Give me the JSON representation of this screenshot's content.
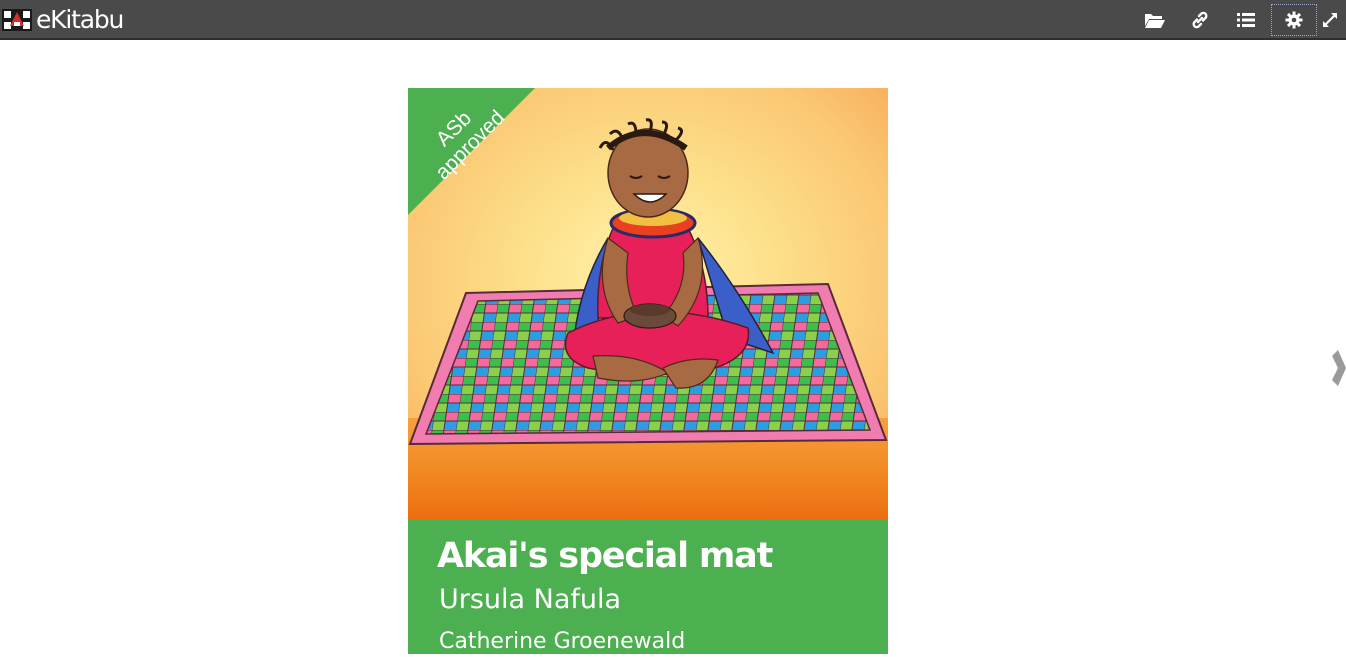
{
  "app": {
    "name": "eKitabu",
    "brand_color": "#4a4a4a",
    "logo_icon": "ekitabu-logo-icon"
  },
  "toolbar": {
    "buttons": [
      {
        "name": "open",
        "icon": "folder-open-icon"
      },
      {
        "name": "link",
        "icon": "link-icon"
      },
      {
        "name": "table-of-contents",
        "icon": "list-icon"
      },
      {
        "name": "settings",
        "icon": "gear-icon",
        "state": "focused"
      },
      {
        "name": "fullscreen",
        "icon": "expand-icon"
      }
    ]
  },
  "navigation": {
    "next_icon": "chevron-right-icon"
  },
  "book": {
    "badge": "ASb approved",
    "title": "Akai's special mat",
    "author": "Ursula Nafula",
    "illustrator": "Catherine Groenewald",
    "panel_color": "#4caf50",
    "illustration": "girl-sitting-on-colorful-mat-illustration"
  }
}
